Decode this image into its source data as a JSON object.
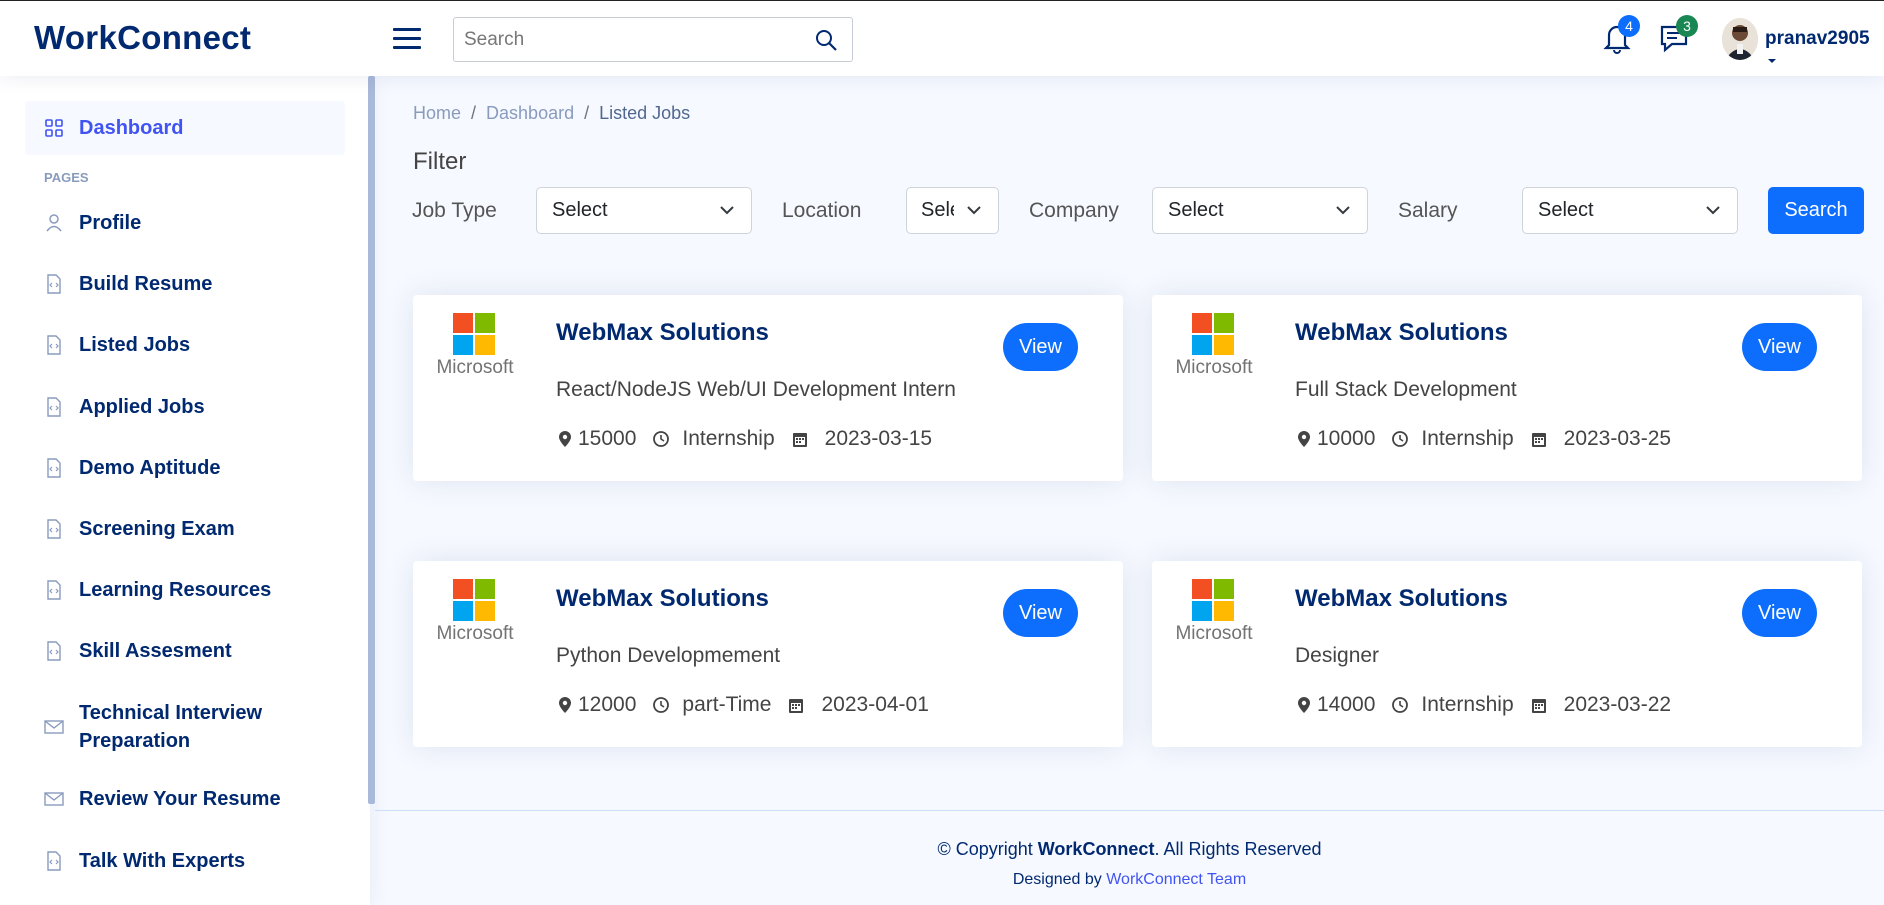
{
  "header": {
    "logo": "WorkConnect",
    "search_placeholder": "Search",
    "notifications_count": "4",
    "messages_count": "3",
    "username": "pranav2905"
  },
  "sidebar": {
    "dashboard": "Dashboard",
    "heading": "PAGES",
    "items": [
      {
        "label": "Profile",
        "icon": "person-icon"
      },
      {
        "label": "Build Resume",
        "icon": "file-code-icon"
      },
      {
        "label": "Listed Jobs",
        "icon": "file-code-icon"
      },
      {
        "label": "Applied Jobs",
        "icon": "file-code-icon"
      },
      {
        "label": "Demo Aptitude",
        "icon": "file-code-icon"
      },
      {
        "label": "Screening Exam",
        "icon": "file-code-icon"
      },
      {
        "label": "Learning Resources",
        "icon": "file-code-icon"
      },
      {
        "label": "Skill Assesment",
        "icon": "file-code-icon"
      },
      {
        "label": "Technical Interview Preparation",
        "icon": "envelope-icon"
      },
      {
        "label": "Review Your Resume",
        "icon": "envelope-icon"
      },
      {
        "label": "Talk With Experts",
        "icon": "file-code-icon"
      }
    ]
  },
  "breadcrumb": [
    "Home",
    "Dashboard",
    "Listed Jobs"
  ],
  "filter": {
    "title": "Filter",
    "job_type_label": "Job Type",
    "job_type_value": "Select",
    "location_label": "Location",
    "location_value": "Select",
    "company_label": "Company",
    "company_value": "Select",
    "salary_label": "Salary",
    "salary_value": "Select",
    "search_button": "Search"
  },
  "jobs": [
    {
      "logo_text": "Microsoft",
      "company": "WebMax Solutions",
      "role": "React/NodeJS Web/UI Development Intern",
      "salary": "15000",
      "type": "Internship",
      "date": "2023-03-15",
      "view": "View"
    },
    {
      "logo_text": "Microsoft",
      "company": "WebMax Solutions",
      "role": "Full Stack Development",
      "salary": "10000",
      "type": "Internship",
      "date": "2023-03-25",
      "view": "View"
    },
    {
      "logo_text": "Microsoft",
      "company": "WebMax Solutions",
      "role": "Python Developmement",
      "salary": "12000",
      "type": "part-Time",
      "date": "2023-04-01",
      "view": "View"
    },
    {
      "logo_text": "Microsoft",
      "company": "WebMax Solutions",
      "role": "Designer",
      "salary": "14000",
      "type": "Internship",
      "date": "2023-03-22",
      "view": "View"
    }
  ],
  "footer": {
    "copy_prefix": "© Copyright ",
    "brand": "WorkConnect",
    "copy_suffix": ". All Rights Reserved",
    "designed_by": "Designed by ",
    "team": "WorkConnect Team"
  },
  "colors": {
    "primary": "#0d6efd",
    "brand": "#012970",
    "accent": "#4154f1"
  }
}
